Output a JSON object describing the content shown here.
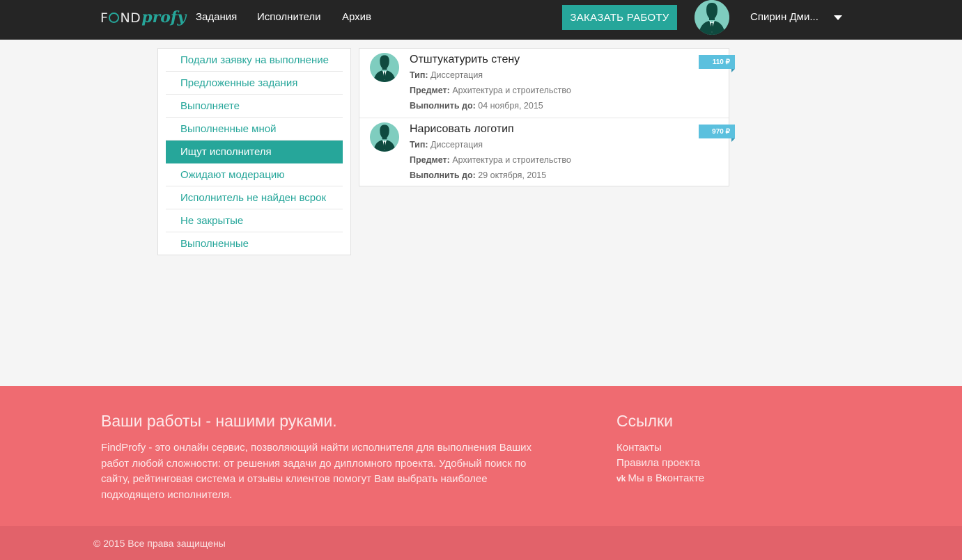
{
  "app": {
    "logo_find": "FIND",
    "logo_profy": "profy"
  },
  "nav": {
    "links": [
      "Задания",
      "Исполнители",
      "Архив"
    ],
    "order_button": "ЗАКАЗАТЬ РАБОТУ",
    "user_name": "Спирин Дми..."
  },
  "sidebar": {
    "items": [
      {
        "label": "Подали заявку на выполнение",
        "active": false
      },
      {
        "label": "Предложенные задания",
        "active": false
      },
      {
        "label": "Выполняете",
        "active": false
      },
      {
        "label": "Выполненные мной",
        "active": false
      },
      {
        "label": "Ищут исполнителя",
        "active": true
      },
      {
        "label": "Ожидают модерацию",
        "active": false
      },
      {
        "label": "Исполнитель не найден всрок",
        "active": false
      },
      {
        "label": "Не закрытые",
        "active": false
      },
      {
        "label": "Выполненные",
        "active": false
      }
    ]
  },
  "tasks": [
    {
      "title": "Отштукатурить стену",
      "type_label": "Тип:",
      "type": "Диссертация",
      "subject_label": "Предмет:",
      "subject": "Архитектура и строительство",
      "due_label": "Выполнить до:",
      "due": "04 ноября, 2015",
      "price": "110 ₽"
    },
    {
      "title": "Нарисовать логотип",
      "type_label": "Тип:",
      "type": "Диссертация",
      "subject_label": "Предмет:",
      "subject": "Архитектура и строительство",
      "due_label": "Выполнить до:",
      "due": "29 октября, 2015",
      "price": "970 ₽"
    }
  ],
  "footer": {
    "title": "Ваши работы - нашими руками.",
    "text": "FindProfy - это онлайн сервис, позволяющий найти исполнителя для выполнения Ваших работ любой сложности: от решения задачи до дипломного проекта. Удобный поиск по сайту, рейтинговая система и отзывы клиентов помогут Вам выбрать наиболее подходящего исполнителя.",
    "links_title": "Ссылки",
    "links": [
      "Контакты",
      "Правила проекта",
      "Мы в Вконтакте"
    ],
    "vk_icon": "vk",
    "copyright": "© 2015 Все права защищены"
  },
  "colors": {
    "accent": "#26a69a",
    "navbar": "#252525",
    "footer": "#ef6b71",
    "footer_bottom": "#e2626a",
    "price_badge": "#5bc0de"
  }
}
